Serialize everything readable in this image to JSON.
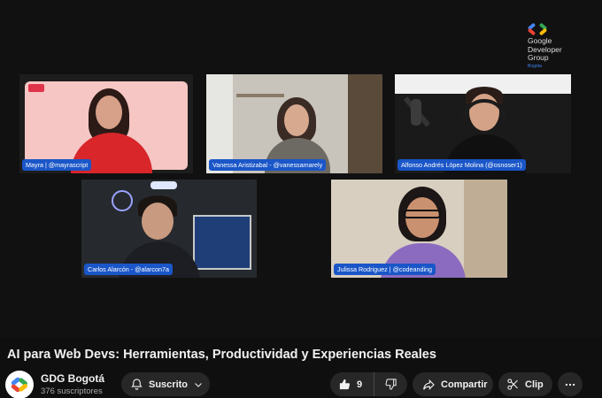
{
  "video": {
    "title": "AI para Web Devs: Herramientas, Productividad y Experiencias Reales"
  },
  "overlay": {
    "logo_text": [
      "Google",
      "Developer",
      "Group"
    ],
    "logo_sub": "Bogota"
  },
  "participants": [
    {
      "name": "Mayra | @mayrascript"
    },
    {
      "name": "Vanessa Aristizabal - @vanessamarely"
    },
    {
      "name": "Alfonso Andrés López Molina (@osnoser1)"
    },
    {
      "name": "Carlos Alarcón - @alarcon7a"
    },
    {
      "name": "Julissa Rodriguez | @codeanding"
    }
  ],
  "channel": {
    "name": "GDG Bogotá",
    "subscribers": "376 suscriptores"
  },
  "actions": {
    "subscribe": "Suscrito",
    "likes": "9",
    "share": "Compartir",
    "clip": "Clip"
  },
  "colors": {
    "background": "#0f0f0f",
    "button_bg": "#272727",
    "name_tag": "#1a56c8",
    "text_primary": "#f1f1f1",
    "text_secondary": "#aaaaaa"
  }
}
